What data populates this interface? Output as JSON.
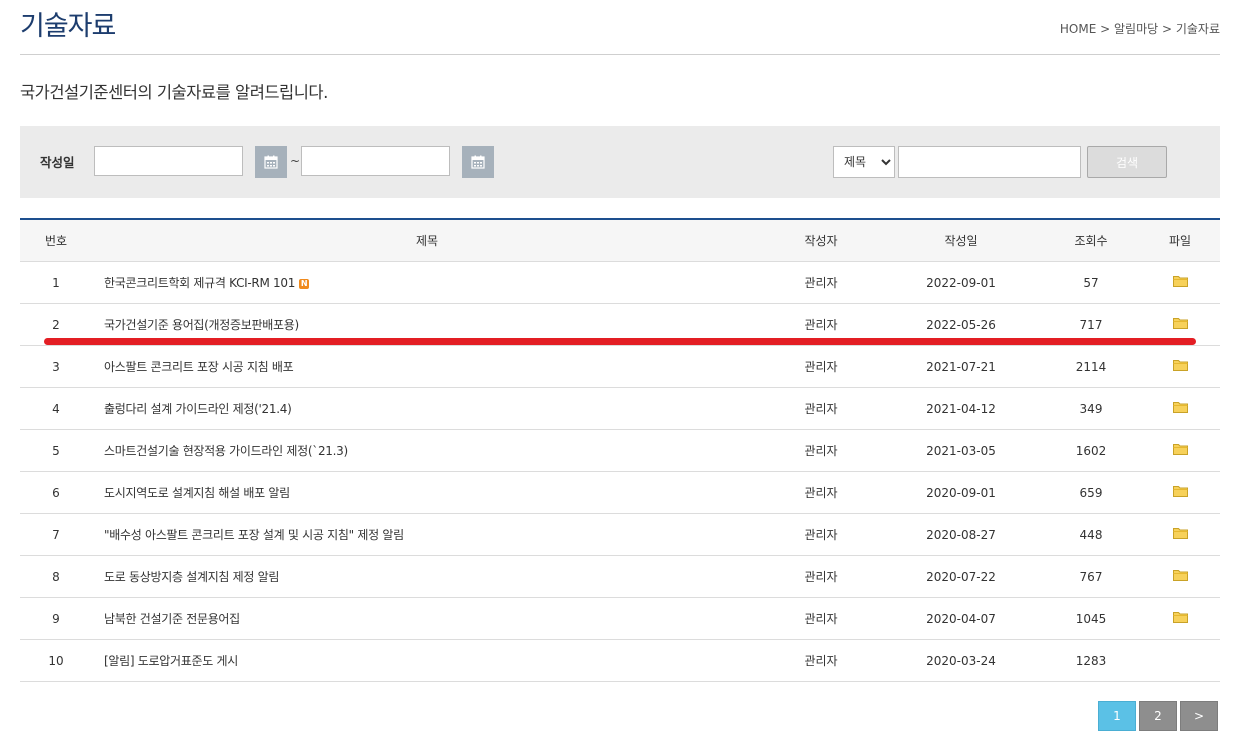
{
  "header": {
    "title": "기술자료",
    "breadcrumb": "HOME > 알림마당 > 기술자료"
  },
  "intro": "국가건설기준센터의 기술자료를 알려드립니다.",
  "search": {
    "date_label": "작성일",
    "date_separator": "~",
    "start_date_value": "",
    "end_date_value": "",
    "field_selected": "제목",
    "keyword_value": "",
    "button_label": "검색"
  },
  "table": {
    "headers": [
      "번호",
      "제목",
      "작성자",
      "작성일",
      "조회수",
      "파일"
    ],
    "rows": [
      {
        "no": "1",
        "title": "한국콘크리트학회 제규격 KCI-RM 101",
        "is_new": true,
        "new_badge": "N",
        "author": "관리자",
        "date": "2022-09-01",
        "views": "57",
        "has_file": true
      },
      {
        "no": "2",
        "title": "국가건설기준 용어집(개정증보판배포용)",
        "is_new": false,
        "author": "관리자",
        "date": "2022-05-26",
        "views": "717",
        "has_file": true
      },
      {
        "no": "3",
        "title": "아스팔트 콘크리트 포장 시공 지침 배포",
        "is_new": false,
        "author": "관리자",
        "date": "2021-07-21",
        "views": "2114",
        "has_file": true
      },
      {
        "no": "4",
        "title": "출렁다리 설계 가이드라인 제정('21.4)",
        "is_new": false,
        "author": "관리자",
        "date": "2021-04-12",
        "views": "349",
        "has_file": true
      },
      {
        "no": "5",
        "title": "스마트건설기술 현장적용 가이드라인 제정(`21.3)",
        "is_new": false,
        "author": "관리자",
        "date": "2021-03-05",
        "views": "1602",
        "has_file": true
      },
      {
        "no": "6",
        "title": "도시지역도로 설계지침 해설 배포 알림",
        "is_new": false,
        "author": "관리자",
        "date": "2020-09-01",
        "views": "659",
        "has_file": true
      },
      {
        "no": "7",
        "title": "\"배수성 아스팔트 콘크리트 포장 설계 및 시공 지침\" 제정 알림",
        "is_new": false,
        "author": "관리자",
        "date": "2020-08-27",
        "views": "448",
        "has_file": true
      },
      {
        "no": "8",
        "title": "도로 동상방지층 설계지침 제정 알림",
        "is_new": false,
        "author": "관리자",
        "date": "2020-07-22",
        "views": "767",
        "has_file": true
      },
      {
        "no": "9",
        "title": "남북한 건설기준 전문용어집",
        "is_new": false,
        "author": "관리자",
        "date": "2020-04-07",
        "views": "1045",
        "has_file": true
      },
      {
        "no": "10",
        "title": "[알림] 도로압거표준도 게시",
        "is_new": false,
        "author": "관리자",
        "date": "2020-03-24",
        "views": "1283",
        "has_file": false
      }
    ]
  },
  "pagination": {
    "pages": [
      "1",
      "2"
    ],
    "active": "1",
    "next_label": ">"
  },
  "colors": {
    "title": "#1d3d6e",
    "table_top_border": "#1d4f8e",
    "annotation_underline": "#e31e24",
    "active_page": "#5bc1e6",
    "new_badge": "#f08a1c"
  }
}
